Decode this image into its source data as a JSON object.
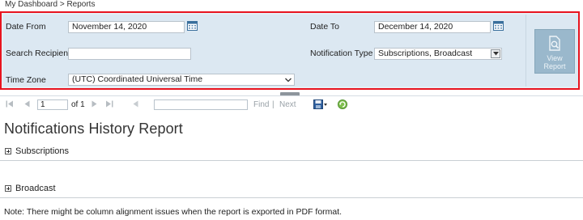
{
  "breadcrumb": {
    "home": "My Dashboard",
    "separator": ">",
    "current": "Reports"
  },
  "params": {
    "date_from_label": "Date From",
    "date_from_value": "November 14, 2020",
    "date_to_label": "Date To",
    "date_to_value": "December 14, 2020",
    "search_recipient_label": "Search Recipient",
    "search_recipient_value": "",
    "notification_type_label": "Notification Type",
    "notification_type_value": "Subscriptions, Broadcast",
    "time_zone_label": "Time Zone",
    "time_zone_value": "(UTC) Coordinated Universal Time",
    "view_report_line1": "View",
    "view_report_line2": "Report"
  },
  "toolbar": {
    "page_value": "1",
    "of_text": "of 1",
    "find_label": "Find",
    "separator": "|",
    "next_label": "Next",
    "search_value": ""
  },
  "report": {
    "title": "Notifications History Report",
    "sections": [
      {
        "label": "Subscriptions"
      },
      {
        "label": "Broadcast"
      }
    ],
    "note": "Note: There might be column alignment issues when the report is exported in PDF format."
  },
  "colors": {
    "highlight_border": "#e8141f",
    "panel_bg": "#dce8f2",
    "button_bg": "#9ab8cc"
  }
}
